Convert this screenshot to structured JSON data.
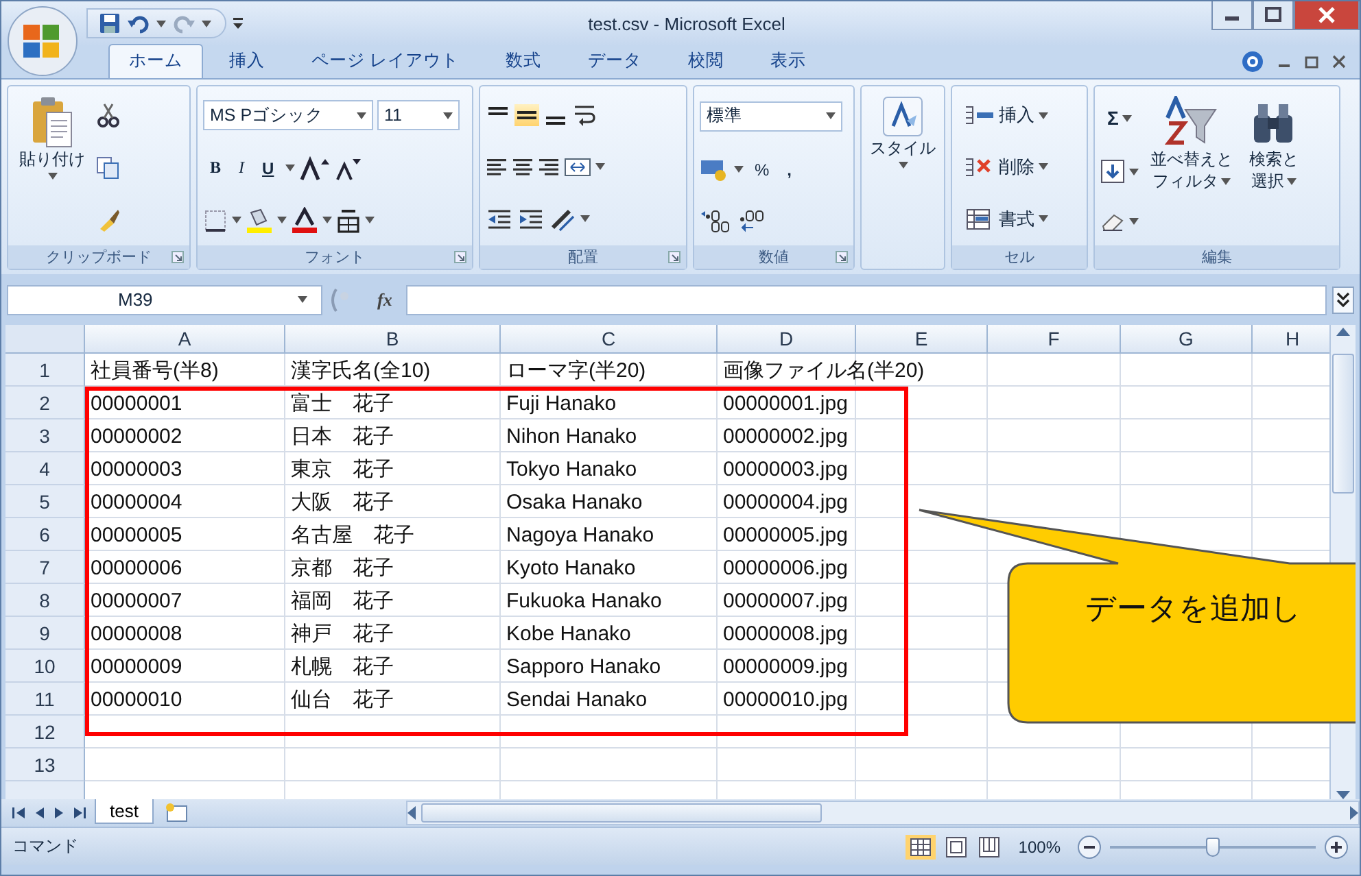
{
  "window": {
    "title": "test.csv - Microsoft Excel"
  },
  "tabs": [
    {
      "label": "ホーム",
      "selected": true
    },
    {
      "label": "挿入",
      "selected": false
    },
    {
      "label": "ページ レイアウト",
      "selected": false
    },
    {
      "label": "数式",
      "selected": false
    },
    {
      "label": "データ",
      "selected": false
    },
    {
      "label": "校閲",
      "selected": false
    },
    {
      "label": "表示",
      "selected": false
    }
  ],
  "clipboard": {
    "paste": "貼り付け",
    "group": "クリップボード"
  },
  "font": {
    "name": "MS Pゴシック",
    "size": "11",
    "styles": [
      "B",
      "I",
      "U"
    ],
    "group": "フォント"
  },
  "alignment": {
    "group": "配置"
  },
  "number": {
    "format": "標準",
    "percent": "%",
    "comma": ",",
    "group": "数値"
  },
  "styles": {
    "label": "スタイル"
  },
  "cells": {
    "items": [
      "挿入",
      "削除",
      "書式"
    ],
    "group": "セル"
  },
  "editing": {
    "sum": "Σ",
    "sort": [
      "並べ替えと",
      "フィルタ"
    ],
    "find": [
      "検索と",
      "選択"
    ],
    "group": "編集"
  },
  "formula_bar": {
    "name_box": "M39",
    "function_label": "fx"
  },
  "sheet": {
    "columns": [
      "A",
      "B",
      "C",
      "D",
      "E",
      "F",
      "G",
      "H"
    ],
    "rows": [
      {
        "number": "1",
        "cells": [
          "社員番号(半8)",
          "漢字氏名(全10)",
          "ローマ字(半20)",
          "画像ファイル名(半20)"
        ]
      },
      {
        "number": "2",
        "cells": [
          "00000001",
          "富士　花子",
          "Fuji Hanako",
          "00000001.jpg"
        ]
      },
      {
        "number": "3",
        "cells": [
          "00000002",
          "日本　花子",
          "Nihon Hanako",
          "00000002.jpg"
        ]
      },
      {
        "number": "4",
        "cells": [
          "00000003",
          "東京　花子",
          "Tokyo Hanako",
          "00000003.jpg"
        ]
      },
      {
        "number": "5",
        "cells": [
          "00000004",
          "大阪　花子",
          "Osaka Hanako",
          "00000004.jpg"
        ]
      },
      {
        "number": "6",
        "cells": [
          "00000005",
          "名古屋　花子",
          "Nagoya Hanako",
          "00000005.jpg"
        ]
      },
      {
        "number": "7",
        "cells": [
          "00000006",
          "京都　花子",
          "Kyoto Hanako",
          "00000006.jpg"
        ]
      },
      {
        "number": "8",
        "cells": [
          "00000007",
          "福岡　花子",
          "Fukuoka Hanako",
          "00000007.jpg"
        ]
      },
      {
        "number": "9",
        "cells": [
          "00000008",
          "神戸　花子",
          "Kobe Hanako",
          "00000008.jpg"
        ]
      },
      {
        "number": "10",
        "cells": [
          "00000009",
          "札幌　花子",
          "Sapporo Hanako",
          "00000009.jpg"
        ]
      },
      {
        "number": "11",
        "cells": [
          "00000010",
          "仙台　花子",
          "Sendai Hanako",
          "00000010.jpg"
        ]
      },
      {
        "number": "12"
      },
      {
        "number": "13"
      }
    ]
  },
  "callout": {
    "text": "データを追加し"
  },
  "sheet_tabs": [
    {
      "label": "test",
      "selected": true
    }
  ],
  "status_bar": {
    "mode": "コマンド",
    "zoom": "100%",
    "zoom_slider": {
      "level": 0.5
    }
  }
}
